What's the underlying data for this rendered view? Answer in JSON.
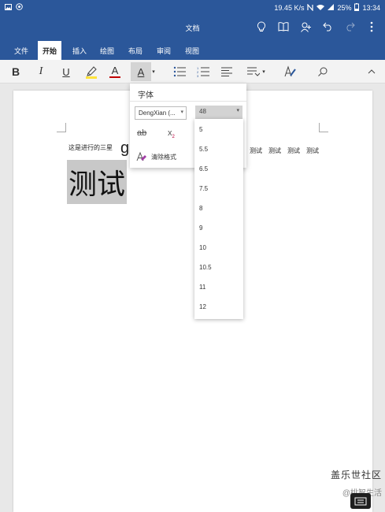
{
  "status_bar": {
    "speed": "19.45 K/s",
    "battery": "25%",
    "time": "13:34"
  },
  "title_bar": {
    "title": "文档"
  },
  "ribbon": {
    "tabs": [
      {
        "label": "文件"
      },
      {
        "label": "开始"
      },
      {
        "label": "插入"
      },
      {
        "label": "绘图"
      },
      {
        "label": "布局"
      },
      {
        "label": "审阅"
      },
      {
        "label": "视图"
      }
    ],
    "active_tab": "开始"
  },
  "toolbar": {
    "bold": "B",
    "italic": "I",
    "underline": "U",
    "font_color_letter": "A",
    "text_effect_letter": "A",
    "text_color_letter": "A"
  },
  "document": {
    "line_text": "这是进行的三星",
    "big_g": "g",
    "right_words": [
      "测试",
      "测试",
      "测试",
      "测试"
    ],
    "heading": "测试"
  },
  "font_panel": {
    "title": "字体",
    "font_name": "DengXian (...",
    "strike_label": "ab",
    "subscript_label": "x",
    "subscript_index": "2",
    "clear_format_label": "清除格式"
  },
  "size_dropdown": {
    "current": "48",
    "options": [
      "5",
      "5.5",
      "6.5",
      "7.5",
      "8",
      "9",
      "10",
      "10.5",
      "11",
      "12"
    ]
  },
  "watermark": {
    "line1": "盖乐世社区",
    "line2": "@桃智生活"
  },
  "colors": {
    "word_blue": "#2b579a",
    "highlight_yellow": "#ffe33b",
    "font_red": "#c00000",
    "clear_format_purple": "#a23ea5"
  }
}
